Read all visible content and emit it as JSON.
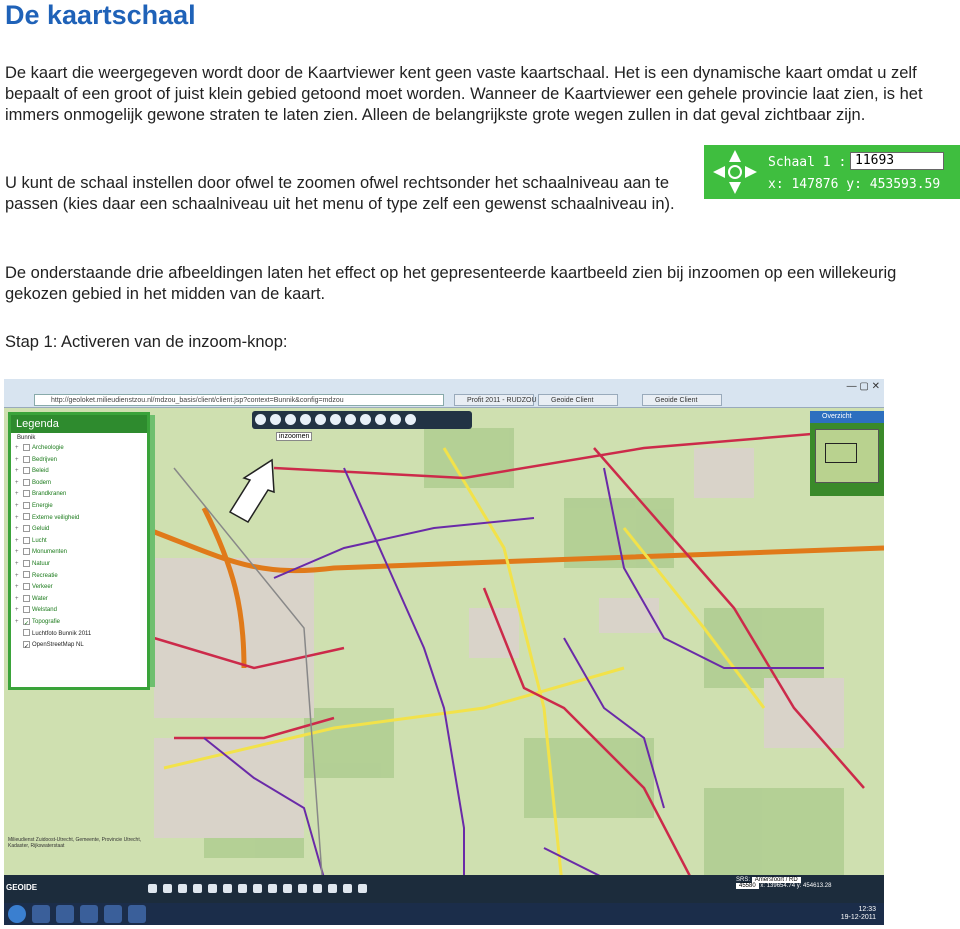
{
  "title": "De kaartschaal",
  "paragraphs": {
    "p1": "De kaart die weergegeven wordt door de Kaartviewer kent geen vaste kaartschaal. Het is een dynamische kaart omdat u zelf bepaalt of een groot of juist klein gebied getoond moet worden. Wanneer de Kaartviewer een gehele provincie laat zien, is het immers onmogelijk gewone straten te laten zien. Alleen de belangrijkste grote wegen zullen in dat geval zichtbaar zijn.",
    "p2": "U kunt de schaal instellen door ofwel te zoomen ofwel rechtsonder het schaalniveau aan te passen (kies daar een schaalniveau uit het menu of type zelf een gewenst schaalniveau in).",
    "p3": "De onderstaande drie afbeeldingen laten het effect op het gepresenteerde kaartbeeld zien bij inzoomen op een willekeurig gekozen gebied in het midden van de kaart.",
    "p4": "Stap 1: Activeren van de inzoom-knop:"
  },
  "scale_widget": {
    "label": "Schaal 1 :",
    "value": "11693",
    "coords": "x: 147876 y: 453593.59",
    "icon": "pan-arrows-icon",
    "color": "#3fbe3f"
  },
  "screenshot": {
    "address": "http://geoloket.milieudienstzou.nl/mdzou_basis/client/client.jsp?context=Bunnik&config=mdzou",
    "tabs": [
      "Profit 2011 - RUDZOU",
      "Geoide Client",
      "Geoide Client"
    ],
    "legend_title": "Legenda",
    "legend_subtitle": "Bunnik",
    "legend_items": [
      "Archeologie",
      "Bedrijven",
      "Beleid",
      "Bodem",
      "Brandkranen",
      "Energie",
      "Externe veiligheid",
      "Geluid",
      "Lucht",
      "Monumenten",
      "Natuur",
      "Recreatie",
      "Verkeer",
      "Water",
      "Welstand",
      "Topografie",
      "Luchtfoto Bunnik 2011",
      "OpenStreetMap NL"
    ],
    "tooltip": "inzoomen",
    "overview_title": "Overzicht",
    "srs_label": "SRS:",
    "srs_value": "Amersfoort / RD",
    "scale_small": "45580",
    "coords_small": "x: 139654.74 y: 454613.28",
    "brand": "GEOIDE",
    "time": "12:33",
    "date": "19-12-2011",
    "copyright": "Milieudienst Zuidoost-Utrecht, Gemeente, Provincie Utrecht, Kadaster, Rijkswaterstaat"
  }
}
